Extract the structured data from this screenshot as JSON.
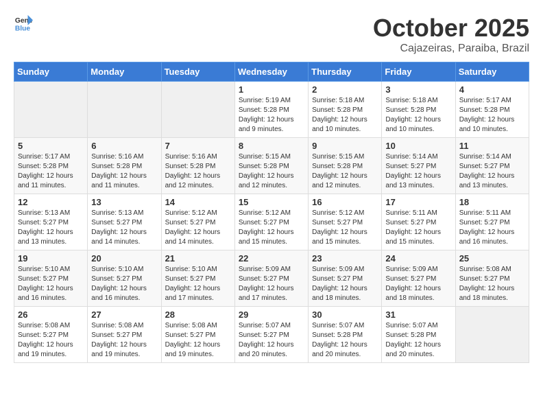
{
  "header": {
    "logo_general": "General",
    "logo_blue": "Blue",
    "month": "October 2025",
    "location": "Cajazeiras, Paraiba, Brazil"
  },
  "weekdays": [
    "Sunday",
    "Monday",
    "Tuesday",
    "Wednesday",
    "Thursday",
    "Friday",
    "Saturday"
  ],
  "rows": [
    [
      {
        "day": "",
        "info": ""
      },
      {
        "day": "",
        "info": ""
      },
      {
        "day": "",
        "info": ""
      },
      {
        "day": "1",
        "info": "Sunrise: 5:19 AM\nSunset: 5:28 PM\nDaylight: 12 hours\nand 9 minutes."
      },
      {
        "day": "2",
        "info": "Sunrise: 5:18 AM\nSunset: 5:28 PM\nDaylight: 12 hours\nand 10 minutes."
      },
      {
        "day": "3",
        "info": "Sunrise: 5:18 AM\nSunset: 5:28 PM\nDaylight: 12 hours\nand 10 minutes."
      },
      {
        "day": "4",
        "info": "Sunrise: 5:17 AM\nSunset: 5:28 PM\nDaylight: 12 hours\nand 10 minutes."
      }
    ],
    [
      {
        "day": "5",
        "info": "Sunrise: 5:17 AM\nSunset: 5:28 PM\nDaylight: 12 hours\nand 11 minutes."
      },
      {
        "day": "6",
        "info": "Sunrise: 5:16 AM\nSunset: 5:28 PM\nDaylight: 12 hours\nand 11 minutes."
      },
      {
        "day": "7",
        "info": "Sunrise: 5:16 AM\nSunset: 5:28 PM\nDaylight: 12 hours\nand 12 minutes."
      },
      {
        "day": "8",
        "info": "Sunrise: 5:15 AM\nSunset: 5:28 PM\nDaylight: 12 hours\nand 12 minutes."
      },
      {
        "day": "9",
        "info": "Sunrise: 5:15 AM\nSunset: 5:28 PM\nDaylight: 12 hours\nand 12 minutes."
      },
      {
        "day": "10",
        "info": "Sunrise: 5:14 AM\nSunset: 5:27 PM\nDaylight: 12 hours\nand 13 minutes."
      },
      {
        "day": "11",
        "info": "Sunrise: 5:14 AM\nSunset: 5:27 PM\nDaylight: 12 hours\nand 13 minutes."
      }
    ],
    [
      {
        "day": "12",
        "info": "Sunrise: 5:13 AM\nSunset: 5:27 PM\nDaylight: 12 hours\nand 13 minutes."
      },
      {
        "day": "13",
        "info": "Sunrise: 5:13 AM\nSunset: 5:27 PM\nDaylight: 12 hours\nand 14 minutes."
      },
      {
        "day": "14",
        "info": "Sunrise: 5:12 AM\nSunset: 5:27 PM\nDaylight: 12 hours\nand 14 minutes."
      },
      {
        "day": "15",
        "info": "Sunrise: 5:12 AM\nSunset: 5:27 PM\nDaylight: 12 hours\nand 15 minutes."
      },
      {
        "day": "16",
        "info": "Sunrise: 5:12 AM\nSunset: 5:27 PM\nDaylight: 12 hours\nand 15 minutes."
      },
      {
        "day": "17",
        "info": "Sunrise: 5:11 AM\nSunset: 5:27 PM\nDaylight: 12 hours\nand 15 minutes."
      },
      {
        "day": "18",
        "info": "Sunrise: 5:11 AM\nSunset: 5:27 PM\nDaylight: 12 hours\nand 16 minutes."
      }
    ],
    [
      {
        "day": "19",
        "info": "Sunrise: 5:10 AM\nSunset: 5:27 PM\nDaylight: 12 hours\nand 16 minutes."
      },
      {
        "day": "20",
        "info": "Sunrise: 5:10 AM\nSunset: 5:27 PM\nDaylight: 12 hours\nand 16 minutes."
      },
      {
        "day": "21",
        "info": "Sunrise: 5:10 AM\nSunset: 5:27 PM\nDaylight: 12 hours\nand 17 minutes."
      },
      {
        "day": "22",
        "info": "Sunrise: 5:09 AM\nSunset: 5:27 PM\nDaylight: 12 hours\nand 17 minutes."
      },
      {
        "day": "23",
        "info": "Sunrise: 5:09 AM\nSunset: 5:27 PM\nDaylight: 12 hours\nand 18 minutes."
      },
      {
        "day": "24",
        "info": "Sunrise: 5:09 AM\nSunset: 5:27 PM\nDaylight: 12 hours\nand 18 minutes."
      },
      {
        "day": "25",
        "info": "Sunrise: 5:08 AM\nSunset: 5:27 PM\nDaylight: 12 hours\nand 18 minutes."
      }
    ],
    [
      {
        "day": "26",
        "info": "Sunrise: 5:08 AM\nSunset: 5:27 PM\nDaylight: 12 hours\nand 19 minutes."
      },
      {
        "day": "27",
        "info": "Sunrise: 5:08 AM\nSunset: 5:27 PM\nDaylight: 12 hours\nand 19 minutes."
      },
      {
        "day": "28",
        "info": "Sunrise: 5:08 AM\nSunset: 5:27 PM\nDaylight: 12 hours\nand 19 minutes."
      },
      {
        "day": "29",
        "info": "Sunrise: 5:07 AM\nSunset: 5:27 PM\nDaylight: 12 hours\nand 20 minutes."
      },
      {
        "day": "30",
        "info": "Sunrise: 5:07 AM\nSunset: 5:28 PM\nDaylight: 12 hours\nand 20 minutes."
      },
      {
        "day": "31",
        "info": "Sunrise: 5:07 AM\nSunset: 5:28 PM\nDaylight: 12 hours\nand 20 minutes."
      },
      {
        "day": "",
        "info": ""
      }
    ]
  ]
}
